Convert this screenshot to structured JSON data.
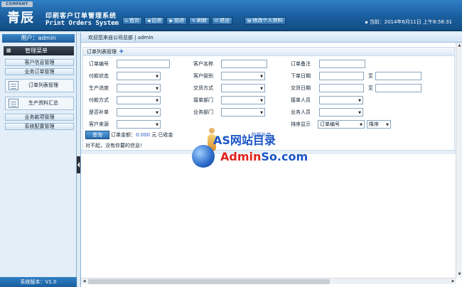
{
  "header": {
    "company_tag": "COMPANY",
    "logo_main": "青辰",
    "logo_sub_cn": "印刷客户订单管理系统",
    "logo_sub_en": "Print Orders System",
    "nav": [
      {
        "icon": "home-icon",
        "glyph": "⌂",
        "label": "首页"
      },
      {
        "icon": "back-icon",
        "glyph": "◀",
        "label": "后退"
      },
      {
        "icon": "forward-icon",
        "glyph": "▶",
        "label": "前进"
      },
      {
        "icon": "refresh-icon",
        "glyph": "↻",
        "label": "刷新"
      },
      {
        "icon": "exit-icon",
        "glyph": "⏻",
        "label": "退出"
      },
      {
        "icon": "edit-profile-icon",
        "glyph": "▤",
        "label": "修改个人资料"
      }
    ],
    "datetime": "当前：2014年6月11日 上午8:58:31"
  },
  "sidebar": {
    "user": "用户：admin",
    "menu_head": "管理菜单",
    "items": [
      {
        "label": "客户信息管理"
      },
      {
        "label": "业务订单管理"
      }
    ],
    "subitems": [
      {
        "label": "订单列表管理"
      },
      {
        "label": "生产资料汇总"
      }
    ],
    "items2": [
      {
        "label": "业务款项管理"
      },
      {
        "label": "系统配置管理"
      }
    ],
    "version": "系统版本：V1.0"
  },
  "main": {
    "welcome": "欢迎您来自公司总部 | admin",
    "panel_title": "订单列表管理",
    "form": {
      "order_no": "订单编号",
      "customer_name": "客户名称",
      "order_note": "订单备注",
      "pay_status": "付款状态",
      "customer_level": "客户级别",
      "order_date": "下单日期",
      "production_progress": "生产进度",
      "delivery_method": "交货方式",
      "delivery_date": "交货日期",
      "pay_method": "付款方式",
      "receive_dept": "接单部门",
      "receiver": "接单人员",
      "is_reissue": "是否补单",
      "business_dept": "业务部门",
      "salesperson": "业务人员",
      "customer_source": "客户来源",
      "sort_display": "排序显示",
      "to": "至",
      "sort_field": "订单编号",
      "sort_order": "降序"
    },
    "query_button": "查询",
    "summary_prefix": "订单金额：",
    "summary_amount": "0.000",
    "summary_suffix": "元 已收金",
    "summary_extra": "的是补单",
    "no_data": "对不起，没有你要的信息!"
  },
  "watermark": {
    "line1": "AS网站目录",
    "line2_red": "Admin",
    "line2_blue": "So.com"
  }
}
